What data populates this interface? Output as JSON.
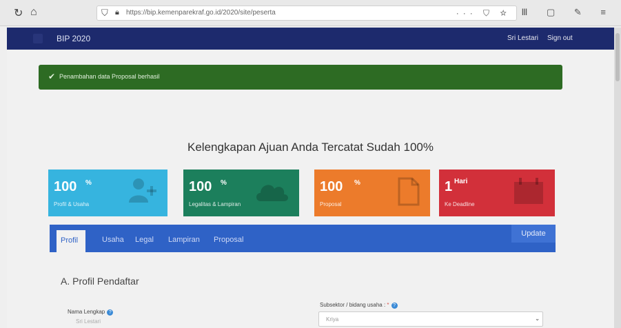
{
  "browser": {
    "url": "https://bip.kemenparekraf.go.id/2020/site/peserta",
    "url_actions": "··· ⛉ ☆",
    "toolbar_icons": "Ⅲ ▢ ✎ ≡"
  },
  "navbar": {
    "brand": "BIP 2020",
    "user": "Sri Lestari",
    "signout": "Sign out"
  },
  "alert": {
    "text": "Penambahan data Proposal berhasil"
  },
  "heading": "Kelengkapan Ajuan Anda Tercatat Sudah 100%",
  "cards": [
    {
      "value": "100",
      "unit": "%",
      "label": "Profil & Usaha",
      "icon": "user-plus-icon"
    },
    {
      "value": "100",
      "unit": "%",
      "label": "Legalitas & Lampiran",
      "icon": "cloud-upload-icon"
    },
    {
      "value": "100",
      "unit": "%",
      "label": "Proposal",
      "icon": "document-icon"
    },
    {
      "value": "1",
      "unit": "Hari",
      "label": "Ke Deadline",
      "icon": "calendar-icon"
    }
  ],
  "tabs": [
    "Profil",
    "Usaha",
    "Legal",
    "Lampiran",
    "Proposal"
  ],
  "update_label": "Update",
  "section": {
    "title": "A. Profil Pendaftar",
    "name_label": "Nama Lengkap",
    "name_value": "Sri Lestari",
    "subsector_label": "Subsektor / bidang usaha :",
    "subsector_required": "*",
    "subsector_value": "Kriya"
  },
  "colors": {
    "navbar": "#1d2a6d",
    "alert": "#2d6b23",
    "card_profile": "#36b4df",
    "card_legal": "#1c7f5c",
    "card_proposal": "#ec7b2b",
    "card_deadline": "#d2303a",
    "tabs": "#2f62c6"
  }
}
